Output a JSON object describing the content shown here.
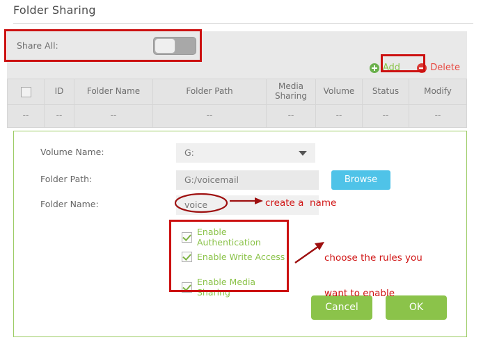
{
  "page": {
    "title": "Folder Sharing"
  },
  "share_all": {
    "label": "Share All:",
    "toggle_state": "off",
    "toggle_name": "share-all-toggle"
  },
  "toolbar": {
    "add_label": "Add",
    "add_icon": "plus-circle-icon",
    "delete_label": "Delete",
    "delete_icon": "minus-circle-icon",
    "add_color": "#8bc34a",
    "delete_color": "#e8473f"
  },
  "table": {
    "columns": [
      "",
      "ID",
      "Folder Name",
      "Folder Path",
      "Media Sharing",
      "Volume",
      "Status",
      "Modify"
    ],
    "rows": [
      [
        "--",
        "--",
        "--",
        "--",
        "--",
        "--",
        "--",
        "--"
      ]
    ],
    "select_all_checked": false
  },
  "form": {
    "volume_name": {
      "label": "Volume Name:",
      "value": "G:",
      "options": [
        "G:"
      ]
    },
    "folder_path": {
      "label": "Folder Path:",
      "value": "G:/voicemail",
      "placeholder": ""
    },
    "folder_name": {
      "label": "Folder Name:",
      "value": "voice",
      "placeholder": ""
    },
    "browse_label": "Browse",
    "browse_color": "#4fc3e8",
    "options": [
      {
        "label": "Enable Authentication",
        "checked": true
      },
      {
        "label": "Enable Write Access",
        "checked": true
      },
      {
        "label": "Enable Media Sharing",
        "checked": true
      }
    ],
    "cancel_label": "Cancel",
    "ok_label": "OK",
    "button_color": "#8bc34a",
    "panel_border_color": "#9ccc65"
  },
  "annotations": {
    "color": "#cc1111",
    "create_name_text": "create a  name",
    "rules_line1": "choose the rules you",
    "rules_line2": "want to enable"
  }
}
